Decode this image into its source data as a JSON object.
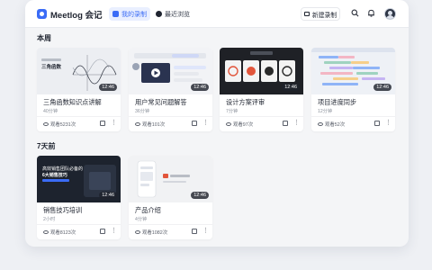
{
  "app": {
    "name": "Meetlog 会记"
  },
  "nav": {
    "tabs": [
      {
        "label": "我的录制"
      },
      {
        "label": "最近浏览"
      }
    ]
  },
  "header": {
    "new_recording_label": "新建录制"
  },
  "sections": [
    {
      "title": "本周",
      "cards": [
        {
          "title": "三角函数知识点讲解",
          "duration": "12:46",
          "meta": "40分钟",
          "views": "观看5231次",
          "thumb_text": "三角函数"
        },
        {
          "title": "用户常见问题解答",
          "duration": "12:46",
          "meta": "36分钟",
          "views": "观看101次"
        },
        {
          "title": "设计方案评审",
          "duration": "12:46",
          "meta": "7分钟",
          "views": "观看97次"
        },
        {
          "title": "项目进度同步",
          "duration": "12:46",
          "meta": "12分钟",
          "views": "观看52次"
        }
      ]
    },
    {
      "title": "7天前",
      "cards": [
        {
          "title": "销售技巧培训",
          "duration": "12:46",
          "meta": "2小时",
          "views": "观看8123次",
          "thumb_text_1": "高效销售团队必备的",
          "thumb_text_2": "6大销售技巧"
        },
        {
          "title": "产品介绍",
          "duration": "12:46",
          "meta": "4分钟",
          "views": "观看1082次"
        }
      ]
    }
  ],
  "colors": {
    "accent": "#3b6cf6",
    "background": "#f4f5f7",
    "card_bg": "#ffffff"
  },
  "icons": [
    "logo-icon",
    "record-icon",
    "clock-icon",
    "camera-icon",
    "search-icon",
    "bell-icon",
    "avatar",
    "eye-icon",
    "share-icon",
    "more-icon"
  ]
}
